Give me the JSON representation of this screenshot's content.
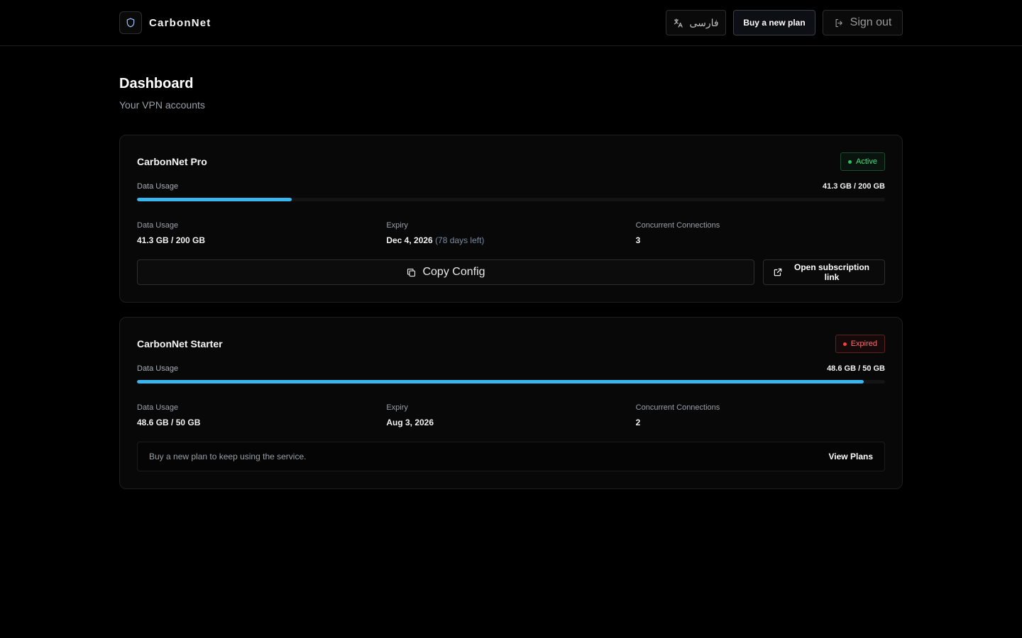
{
  "header": {
    "brand_name": "CarbonNet",
    "language_label": "فارسی",
    "buy_label": "Buy a new plan",
    "signout_label": "Sign out"
  },
  "page": {
    "title": "Dashboard",
    "subtitle": "Your VPN accounts"
  },
  "accounts": [
    {
      "name": "CarbonNet Pro",
      "status": "Active",
      "usage_label": "Data Usage",
      "usage_value": "41.3 GB / 200 GB",
      "usage_fraction": 0.2065,
      "stats": {
        "usage_label": "Data Usage",
        "usage_value": "41.3 GB / 200 GB",
        "expiry_label": "Expiry",
        "expiry_value": "Dec 4, 2026",
        "expiry_sub": "(78 days left)",
        "connections_label": "Concurrent Connections",
        "connections_value": "3"
      },
      "copy_label": "Copy Config",
      "open_label": "Open subscription link"
    },
    {
      "name": "CarbonNet Starter",
      "status": "Expired",
      "usage_label": "Data Usage",
      "usage_value": "48.6 GB / 50 GB",
      "usage_fraction": 0.972,
      "stats": {
        "usage_label": "Data Usage",
        "usage_value": "48.6 GB / 50 GB",
        "expiry_label": "Expiry",
        "expiry_value": "Aug 3, 2026",
        "connections_label": "Concurrent Connections",
        "connections_value": "2"
      },
      "notice_text": "Buy a new plan to keep using the service.",
      "notice_link": "View Plans"
    }
  ],
  "colors": {
    "accent": "#38b6f0",
    "active": "#4ade80",
    "expired": "#f87171"
  },
  "icons": {
    "logo": "shield-icon",
    "language": "translate-icon",
    "signout": "sign-out-icon",
    "copy": "copy-icon",
    "open": "external-link-icon"
  }
}
